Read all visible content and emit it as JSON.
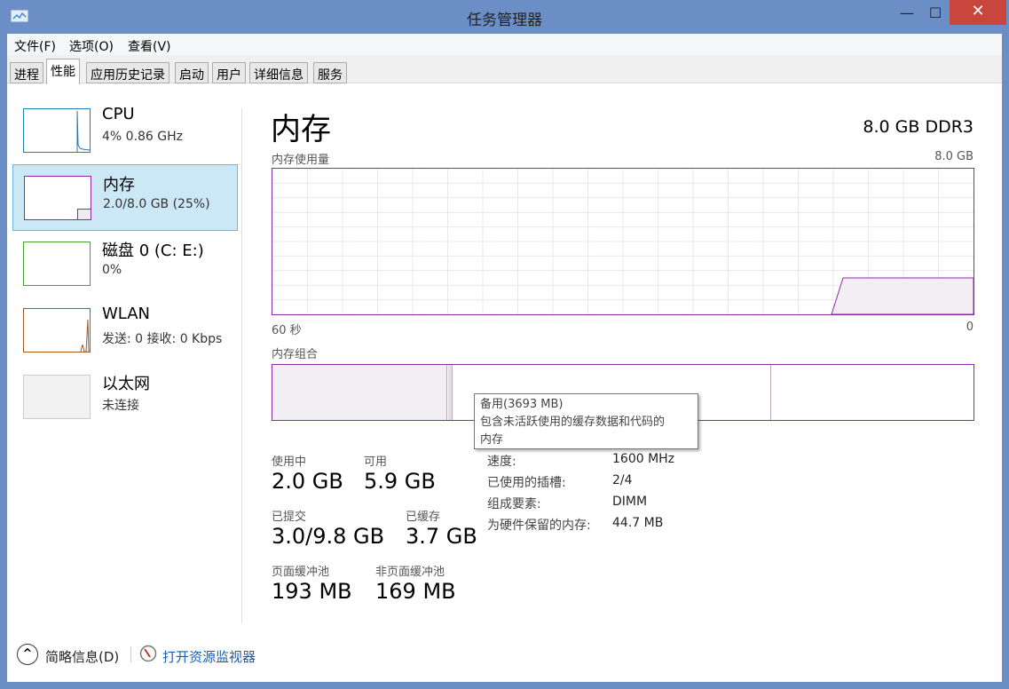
{
  "window": {
    "title": "任务管理器",
    "minimize": "—",
    "maximize": "☐",
    "close": "✕"
  },
  "menu": [
    "文件(F)",
    "选项(O)",
    "查看(V)"
  ],
  "tabs": [
    "进程",
    "性能",
    "应用历史记录",
    "启动",
    "用户",
    "详细信息",
    "服务"
  ],
  "active_tab": "性能",
  "sidebar": [
    {
      "name": "CPU",
      "sub": "4% 0.86 GHz",
      "color": "#1c7cb8"
    },
    {
      "name": "内存",
      "sub": "2.0/8.0 GB (25%)",
      "color": "#8b2aa6"
    },
    {
      "name": "磁盘 0 (C: E:)",
      "sub": "0%",
      "color": "#4da02d"
    },
    {
      "name": "WLAN",
      "sub": "发送: 0 接收: 0 Kbps",
      "color": "#a7581a"
    },
    {
      "name": "以太网",
      "sub": "未连接",
      "color": "#bbbbbb"
    }
  ],
  "main": {
    "title": "内存",
    "spec": "8.0 GB DDR3",
    "usage_label": "内存使用量",
    "usage_max": "8.0 GB",
    "x_left": "60 秒",
    "x_right": "0",
    "usage_percent": 25,
    "composition_label": "内存组合",
    "tooltip": {
      "line1": "备用(3693 MB)",
      "line2": "包含未活跃使用的缓存数据和代码的",
      "line3": "内存"
    },
    "stats": [
      {
        "label": "使用中",
        "value": "2.0 GB"
      },
      {
        "label": "可用",
        "value": "5.9 GB"
      },
      {
        "label": "已提交",
        "value": "3.0/9.8 GB"
      },
      {
        "label": "已缓存",
        "value": "3.7 GB"
      },
      {
        "label": "页面缓冲池",
        "value": "193 MB"
      },
      {
        "label": "非页面缓冲池",
        "value": "169 MB"
      }
    ],
    "props": [
      {
        "k": "速度:",
        "v": "1600 MHz"
      },
      {
        "k": "已使用的插槽:",
        "v": "2/4"
      },
      {
        "k": "组成要素:",
        "v": "DIMM"
      },
      {
        "k": "为硬件保留的内存:",
        "v": "44.7 MB"
      }
    ]
  },
  "footer": {
    "summary": "简略信息(D)",
    "monitor": "打开资源监视器"
  },
  "accent": "#8b2aa6"
}
